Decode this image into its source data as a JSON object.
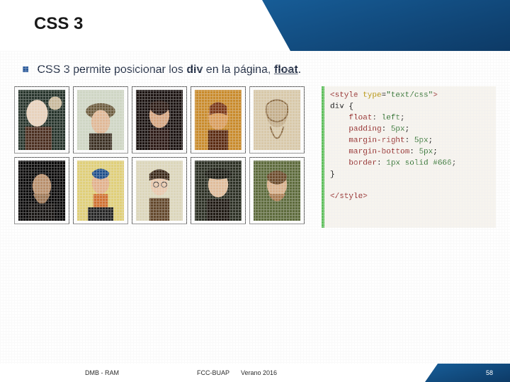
{
  "title": "CSS 3",
  "body_prefix": "CSS 3 permite posicionar los ",
  "body_kw1": "div",
  "body_mid": " en la página, ",
  "body_kw2": "float",
  "body_suffix": ".",
  "code": {
    "open_tag": "<style",
    "attr_name": " type",
    "attr_eq": "=",
    "attr_val": "\"text/css\"",
    "open_end": ">",
    "sel": "div {",
    "p1k": "float",
    "p1v": "left",
    "p2k": "padding",
    "p2v": "5px",
    "p3k": "margin-right",
    "p3v": "5px",
    "p4k": "margin-bottom",
    "p4v": "5px",
    "p5k": "border",
    "p5v": "1px solid #666",
    "close_brace": "}",
    "close_tag": "</style>"
  },
  "footer": {
    "left": "DMB - RAM",
    "center": "FCC-BUAP",
    "center2": "Verano 2016",
    "page": "58"
  }
}
